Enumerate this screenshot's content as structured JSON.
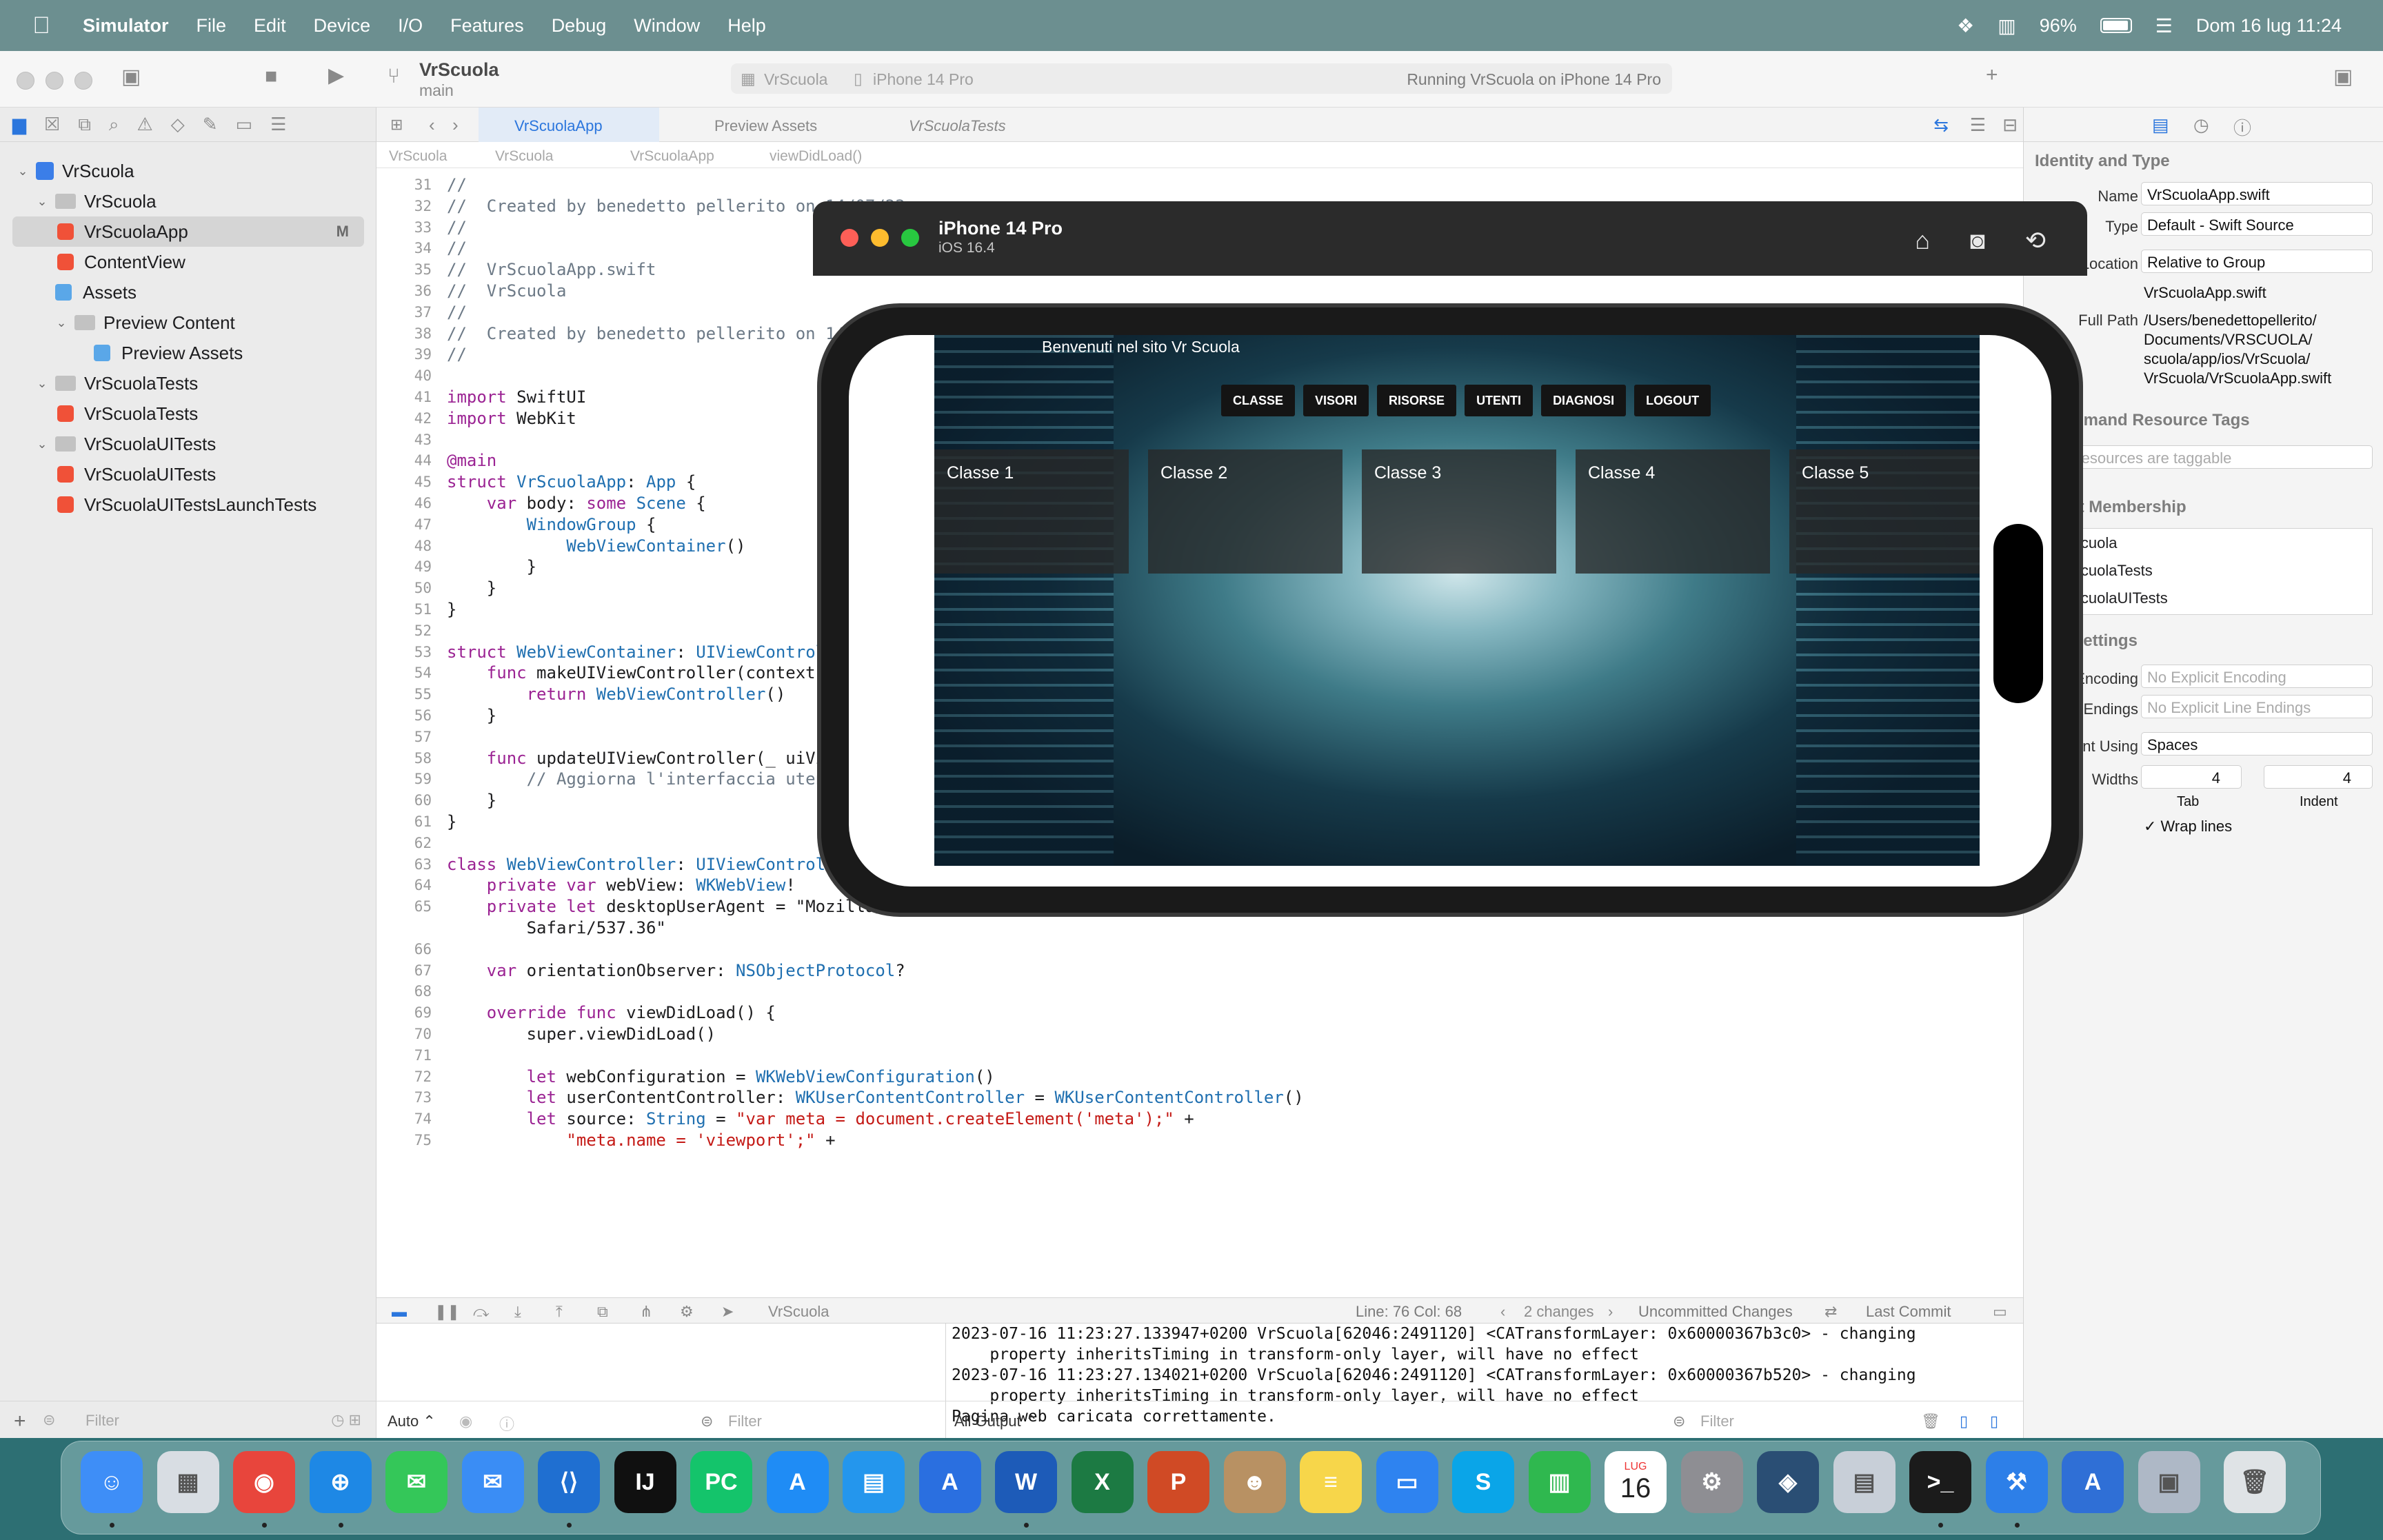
{
  "menubar": {
    "app": "Simulator",
    "items": [
      "File",
      "Edit",
      "Device",
      "I/O",
      "Features",
      "Debug",
      "Window",
      "Help"
    ],
    "battery": "96%",
    "datetime": "Dom 16 lug  11:24"
  },
  "toolbar": {
    "project": "VrScuola",
    "branch": "main",
    "scheme": "VrScuola",
    "destination": "iPhone 14 Pro",
    "status": "Running VrScuola on iPhone 14 Pro"
  },
  "navigator": {
    "items": [
      {
        "label": "VrScuola",
        "kind": "proj"
      },
      {
        "label": "VrScuola",
        "kind": "folder"
      },
      {
        "label": "VrScuolaApp",
        "kind": "swift",
        "badge": "M"
      },
      {
        "label": "ContentView",
        "kind": "swift"
      },
      {
        "label": "Assets",
        "kind": "assets"
      },
      {
        "label": "Preview Content",
        "kind": "folder"
      },
      {
        "label": "Preview Assets",
        "kind": "assets"
      },
      {
        "label": "VrScuolaTests",
        "kind": "folder"
      },
      {
        "label": "VrScuolaTests",
        "kind": "swift"
      },
      {
        "label": "VrScuolaUITests",
        "kind": "folder"
      },
      {
        "label": "VrScuolaUITests",
        "kind": "swift"
      },
      {
        "label": "VrScuolaUITestsLaunchTests",
        "kind": "swift"
      }
    ],
    "filter_placeholder": "Filter"
  },
  "editor": {
    "tabs": [
      "VrScuolaApp",
      "Preview Assets",
      "VrScuolaTests"
    ],
    "jumpbar": [
      "VrScuola",
      "VrScuola",
      "VrScuolaApp",
      "viewDidLoad()"
    ],
    "line_numbers": [
      "31",
      "32",
      "33",
      "34",
      "35",
      "36",
      "37",
      "38",
      "39",
      "40",
      "41",
      "42",
      "43",
      "44",
      "45",
      "46",
      "47",
      "48",
      "49",
      "50",
      "51",
      "52",
      "53",
      "54",
      "55",
      "56",
      "57",
      "58",
      "59",
      "60",
      "61",
      "62",
      "63",
      "64",
      "65",
      "",
      "66",
      "67",
      "68",
      "69",
      "70",
      "71",
      "72",
      "73",
      "74",
      "75"
    ],
    "code_lines": [
      "//",
      "//  Created by benedetto pellerito on 14/07/23.",
      "//",
      "//",
      "//  VrScuolaApp.swift",
      "//  VrScuola",
      "//",
      "//  Created by benedetto pellerito on 14/07/23.",
      "//",
      "",
      "import SwiftUI",
      "import WebKit",
      "",
      "@main",
      "struct VrScuolaApp: App {",
      "    var body: some Scene {",
      "        WindowGroup {",
      "            WebViewContainer()",
      "        }",
      "    }",
      "}",
      "",
      "struct WebViewContainer: UIViewControllerRepresentable {",
      "    func makeUIViewController(context: Context) -> WebViewController {",
      "        return WebViewController()",
      "    }",
      "",
      "    func updateUIViewController(_ uiViewController: WebViewController, context: Context) {",
      "        // Aggiorna l'interfaccia utente se necessario",
      "    }",
      "}",
      "",
      "class WebViewController: UIViewController, WKNavigationDelegate, WKUIDelegate {",
      "    private var webView: WKWebView!",
      "    private let desktopUserAgent = \"Mozilla/5.0 (Macintosh; Intel Mac OS X 10_15_0) AppleWebKit/537.36 (KHTML, like Gecko) Chrome/78.0.3904.97",
      "        Safari/537.36\"",
      "",
      "    var orientationObserver: NSObjectProtocol?",
      "",
      "    override func viewDidLoad() {",
      "        super.viewDidLoad()",
      "",
      "        let webConfiguration = WKWebViewConfiguration()",
      "        let userContentController: WKUserContentController = WKUserContentController()",
      "        let source: String = \"var meta = document.createElement('meta');\" +",
      "            \"meta.name = 'viewport';\" +"
    ]
  },
  "debug": {
    "scheme": "VrScuola",
    "line_col": "Line: 76  Col: 68",
    "changes": "2 changes",
    "uncommitted": "Uncommitted Changes",
    "last_commit": "Last Commit",
    "console_lines": [
      "2023-07-16 11:23:27.133947+0200 VrScuola[62046:2491120] <CATransformLayer: 0x60000367b3c0> - changing",
      "    property inheritsTiming in transform-only layer, will have no effect",
      "2023-07-16 11:23:27.134021+0200 VrScuola[62046:2491120] <CATransformLayer: 0x60000367b520> - changing",
      "    property inheritsTiming in transform-only layer, will have no effect",
      "Pagina web caricata correttamente."
    ],
    "auto_label": "Auto ⌃",
    "filter_placeholder": "Filter",
    "output_label": "All Output ⌃"
  },
  "inspector": {
    "identity_title": "Identity and Type",
    "name_label": "Name",
    "name_value": "VrScuolaApp.swift",
    "type_label": "Type",
    "type_value": "Default - Swift Source",
    "location_label": "Location",
    "location_value": "Relative to Group",
    "location_file": "VrScuolaApp.swift",
    "fullpath_label": "Full Path",
    "fullpath_lines": [
      "/Users/benedettopellerito/",
      "Documents/VRSCUOLA/",
      "scuola/app/ios/VrScuola/",
      "VrScuola/VrScuolaApp.swift"
    ],
    "odr_title": "On Demand Resource Tags",
    "odr_placeholder": "Only resources are taggable",
    "membership_title": "Target Membership",
    "targets": [
      "VrScuola",
      "VrScuolaTests",
      "VrScuolaUITests"
    ],
    "text_settings_title": "Text Settings",
    "encoding_label": "Text Encoding",
    "encoding_value": "No Explicit Encoding",
    "endings_label": "Line Endings",
    "endings_value": "No Explicit Line Endings",
    "indent_label": "Indent Using",
    "indent_value": "Spaces",
    "widths_label": "Widths",
    "tab_value": "4",
    "indent_width_value": "4",
    "tab_caption": "Tab",
    "indent_caption": "Indent",
    "wrap_label": "Wrap lines"
  },
  "simulator": {
    "device": "iPhone 14 Pro",
    "os": "iOS 16.4",
    "site_title": "Benvenuti nel sito Vr Scuola",
    "nav": [
      "CLASSE",
      "VISORI",
      "RISORSE",
      "UTENTI",
      "DIAGNOSI",
      "LOGOUT"
    ],
    "classes": [
      "Classe 1",
      "Classe 2",
      "Classe 3",
      "Classe 4",
      "Classe 5"
    ]
  },
  "dock": {
    "calendar_month": "LUG",
    "calendar_day": "16",
    "apps": [
      {
        "name": "finder",
        "color": "#3e8ef7",
        "glyph": "☺"
      },
      {
        "name": "launchpad",
        "color": "#d8dde3",
        "glyph": "▦"
      },
      {
        "name": "chrome",
        "color": "#e8453c",
        "glyph": "◉"
      },
      {
        "name": "safari",
        "color": "#1e88e5",
        "glyph": "⊕"
      },
      {
        "name": "messages",
        "color": "#34c759",
        "glyph": "✉"
      },
      {
        "name": "mail",
        "color": "#3a8df5",
        "glyph": "✉"
      },
      {
        "name": "vscode",
        "color": "#1f6fd1",
        "glyph": "⟨⟩"
      },
      {
        "name": "intellij",
        "color": "#101010",
        "glyph": "IJ"
      },
      {
        "name": "pycharm",
        "color": "#14c46b",
        "glyph": "PC"
      },
      {
        "name": "app-store",
        "color": "#1f8cf5",
        "glyph": "A"
      },
      {
        "name": "docker",
        "color": "#2496ed",
        "glyph": "▤"
      },
      {
        "name": "instruments",
        "color": "#2a6fe0",
        "glyph": "A"
      },
      {
        "name": "word",
        "color": "#1d5bb8",
        "glyph": "W"
      },
      {
        "name": "excel",
        "color": "#1c7a43",
        "glyph": "X"
      },
      {
        "name": "powerpoint",
        "color": "#d04a25",
        "glyph": "P"
      },
      {
        "name": "contacts",
        "color": "#b89163",
        "glyph": "☻"
      },
      {
        "name": "notes",
        "color": "#f7d64a",
        "glyph": "≡"
      },
      {
        "name": "keynote",
        "color": "#2e83f0",
        "glyph": "▭"
      },
      {
        "name": "skype",
        "color": "#0aa5e8",
        "glyph": "S"
      },
      {
        "name": "numbers",
        "color": "#2fb84f",
        "glyph": "▥"
      },
      {
        "name": "calendar",
        "color": "#ffffff",
        "glyph": ""
      },
      {
        "name": "system-settings",
        "color": "#8e8e93",
        "glyph": "⚙"
      },
      {
        "name": "mysql-workbench",
        "color": "#2a4e74",
        "glyph": "◈"
      },
      {
        "name": "db-browser",
        "color": "#c8cfd8",
        "glyph": "▤"
      },
      {
        "name": "terminal",
        "color": "#1b1b1b",
        "glyph": ">_"
      },
      {
        "name": "xcode",
        "color": "#2d7fe8",
        "glyph": "⚒"
      },
      {
        "name": "xcode-beta",
        "color": "#2f6fd6",
        "glyph": "A"
      },
      {
        "name": "preview",
        "color": "#aeb8c6",
        "glyph": "▣"
      },
      {
        "name": "trash",
        "color": "#dfe3e6",
        "glyph": "🗑"
      }
    ]
  }
}
